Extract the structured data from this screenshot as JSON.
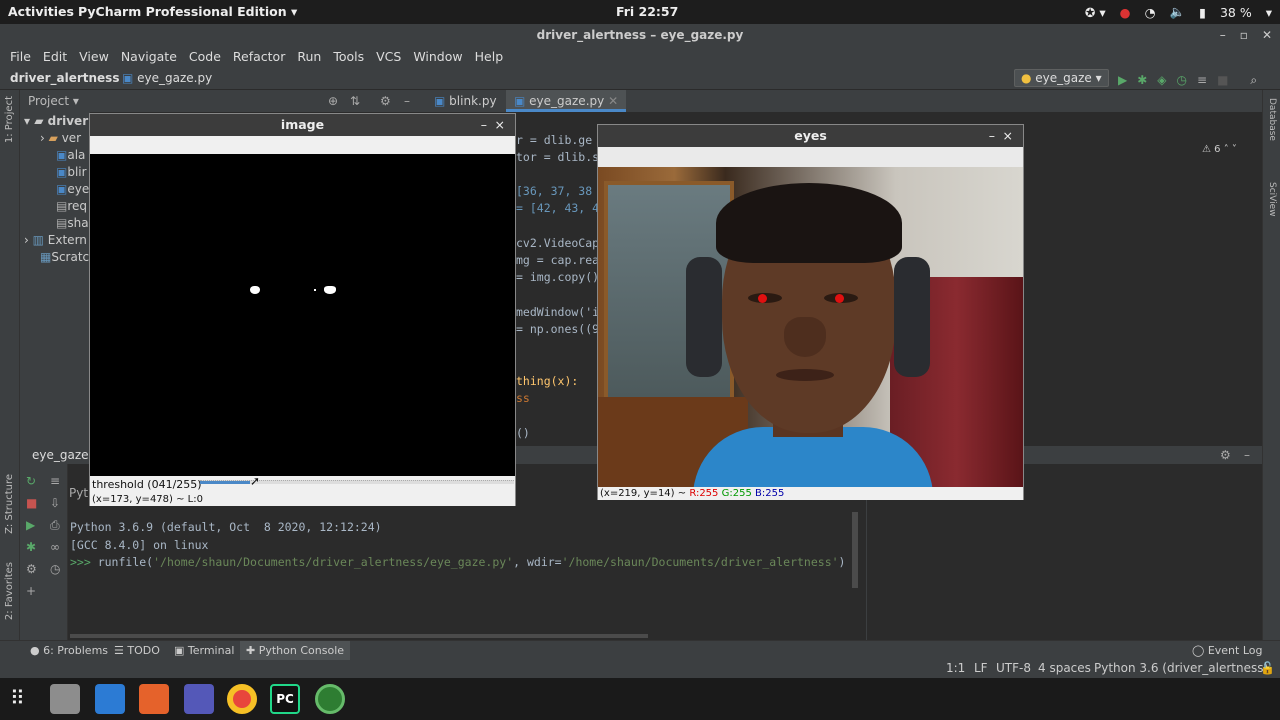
{
  "topbar": {
    "activities": "Activities",
    "app": "PyCharm Professional Edition ▾",
    "clock": "Fri 22:57",
    "battery": "38 %"
  },
  "window": {
    "title": "driver_alertness – eye_gaze.py"
  },
  "menu": [
    "File",
    "Edit",
    "View",
    "Navigate",
    "Code",
    "Refactor",
    "Run",
    "Tools",
    "VCS",
    "Window",
    "Help"
  ],
  "nav": {
    "project": "driver_alertness",
    "file": "eye_gaze.py",
    "run_config": "eye_gaze ▾"
  },
  "project_panel": {
    "title": "Project ▾",
    "root": "driver",
    "items": [
      "ver",
      "ala",
      "blir",
      "eye",
      "req",
      "sha"
    ],
    "external": "Extern",
    "scratches": "Scratc"
  },
  "tabs": [
    "blink.py",
    "eye_gaze.py"
  ],
  "editor": {
    "lines": [
      "r = dlib.ge",
      "tor = dlib.sh",
      "[36, 37, 38",
      "= [42, 43, 44",
      "cv2.VideoCapt",
      "mg = cap.read",
      "= img.copy()",
      "medWindow('im",
      "= np.ones((9",
      "thing(x):",
      "ss",
      "()"
    ],
    "warnings": "6"
  },
  "run_panel": {
    "title": "eye_gaze",
    "tab_label": "Pyt"
  },
  "console": {
    "line1": "Python 3.6.9 (default, Oct  8 2020, 12:12:24)",
    "line2": "[GCC 8.4.0] on linux",
    "prompt": ">>> ",
    "cmd_fn": "runfile(",
    "cmd_arg1": "'/home/shaun/Documents/driver_alertness/eye_gaze.py'",
    "cmd_sep": ", wdir=",
    "cmd_arg2": "'/home/shaun/Documents/driver_alertness'",
    "cmd_end": ")"
  },
  "bottom_tabs": [
    "6: Problems",
    "TODO",
    "Terminal",
    "Python Console"
  ],
  "event_log": "Event Log",
  "status": {
    "pos": "1:1",
    "lf": "LF",
    "enc": "UTF-8",
    "indent": "4 spaces",
    "interp": "Python 3.6 (driver_alertness)"
  },
  "image_window": {
    "title": "image",
    "slider_label": "threshold  (041/255)",
    "slider_value": 41,
    "slider_max": 255,
    "status": "(x=173, y=478) ~ L:0"
  },
  "eyes_window": {
    "title": "eyes",
    "status_pos": "(x=219, y=14) ~",
    "status_r": "R:255",
    "status_g": "G:255",
    "status_b": "B:255"
  },
  "side_labels": {
    "project": "1: Project",
    "structure": "Z: Structure",
    "favorites": "2: Favorites",
    "database": "Database",
    "sciview": "SciView"
  }
}
